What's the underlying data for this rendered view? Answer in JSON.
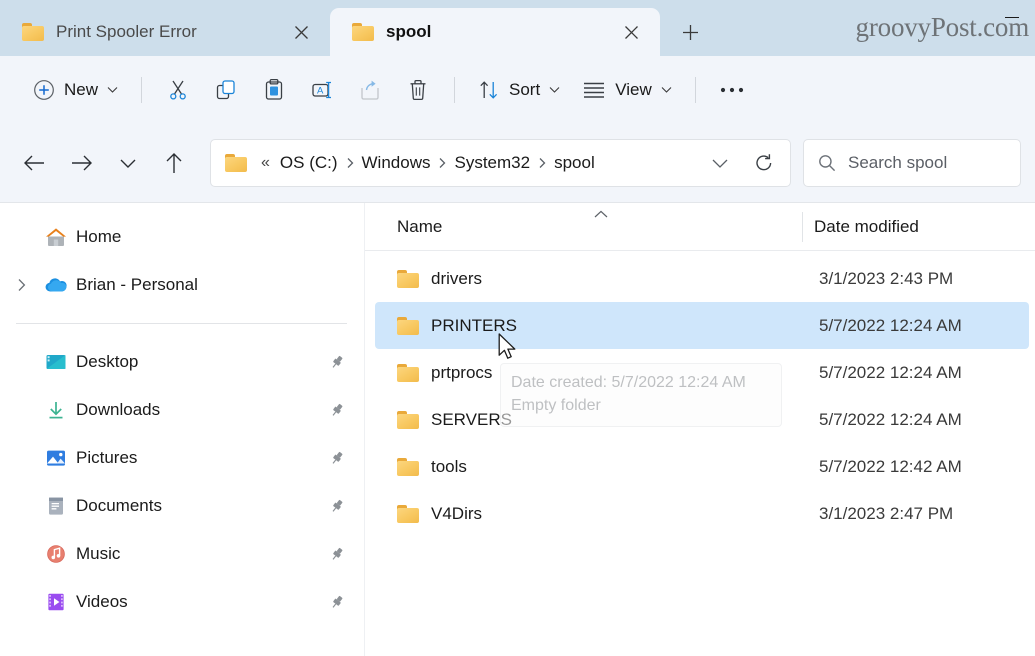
{
  "window": {
    "watermark": "groovyPost.com",
    "minimize_label": "Minimize"
  },
  "tabs": [
    {
      "title": "Print Spooler Error",
      "active": false,
      "icon": "folder-icon",
      "close": "close-icon"
    },
    {
      "title": "spool",
      "active": true,
      "icon": "folder-icon",
      "close": "close-icon"
    }
  ],
  "newtab_label": "+",
  "toolbar": {
    "new_label": "New",
    "sort_label": "Sort",
    "view_label": "View",
    "cut_icon": "cut-icon",
    "copy_icon": "copy-icon",
    "paste_icon": "paste-icon",
    "rename_icon": "rename-icon",
    "share_icon": "share-icon",
    "delete_icon": "delete-icon",
    "more_icon": "more-options-icon"
  },
  "navigation": {
    "back": "back-arrow-icon",
    "forward": "forward-arrow-icon",
    "recent": "recent-locations-icon",
    "up": "up-arrow-icon",
    "refresh": "refresh-icon",
    "dropdown": "chevron-down-icon"
  },
  "address": {
    "ellipsis": "«",
    "crumbs": [
      "OS (C:)",
      "Windows",
      "System32",
      "spool"
    ],
    "separator": "›"
  },
  "search": {
    "placeholder": "Search spool",
    "icon": "search-icon"
  },
  "sidebar": {
    "groups": [
      {
        "items": [
          {
            "label": "Home",
            "icon": "home-icon",
            "chevron": false,
            "pin": false
          },
          {
            "label": "Brian - Personal",
            "icon": "onedrive-icon",
            "chevron": true,
            "pin": false
          }
        ]
      },
      {
        "items": [
          {
            "label": "Desktop",
            "icon": "desktop-icon",
            "chevron": false,
            "pin": true
          },
          {
            "label": "Downloads",
            "icon": "downloads-icon",
            "chevron": false,
            "pin": true
          },
          {
            "label": "Pictures",
            "icon": "pictures-icon",
            "chevron": false,
            "pin": true
          },
          {
            "label": "Documents",
            "icon": "documents-icon",
            "chevron": false,
            "pin": true
          },
          {
            "label": "Music",
            "icon": "music-icon",
            "chevron": false,
            "pin": true
          },
          {
            "label": "Videos",
            "icon": "videos-icon",
            "chevron": false,
            "pin": true
          }
        ]
      }
    ]
  },
  "filelist": {
    "columns": {
      "name": "Name",
      "date_modified": "Date modified"
    },
    "sort": {
      "column": "Name",
      "direction": "ascending",
      "icon": "sort-ascending-caret"
    },
    "rows": [
      {
        "name": "drivers",
        "date_modified": "3/1/2023 2:43 PM",
        "selected": false
      },
      {
        "name": "PRINTERS",
        "date_modified": "5/7/2022 12:24 AM",
        "selected": true
      },
      {
        "name": "prtprocs",
        "date_modified": "5/7/2022 12:24 AM",
        "selected": false
      },
      {
        "name": "SERVERS",
        "date_modified": "5/7/2022 12:24 AM",
        "selected": false
      },
      {
        "name": "tools",
        "date_modified": "5/7/2022 12:42 AM",
        "selected": false
      },
      {
        "name": "V4Dirs",
        "date_modified": "3/1/2023 2:47 PM",
        "selected": false
      }
    ]
  },
  "tooltip": {
    "line1": "Date created: 5/7/2022 12:24 AM",
    "line2": "Empty folder"
  },
  "colors": {
    "tabstrip_bg": "#cddeeb",
    "toolbar_bg": "#f2f5fa",
    "selection_bg": "#cfe6fb",
    "accent_blue": "#0f6cbd",
    "folder_yellow": "#f8c860"
  }
}
